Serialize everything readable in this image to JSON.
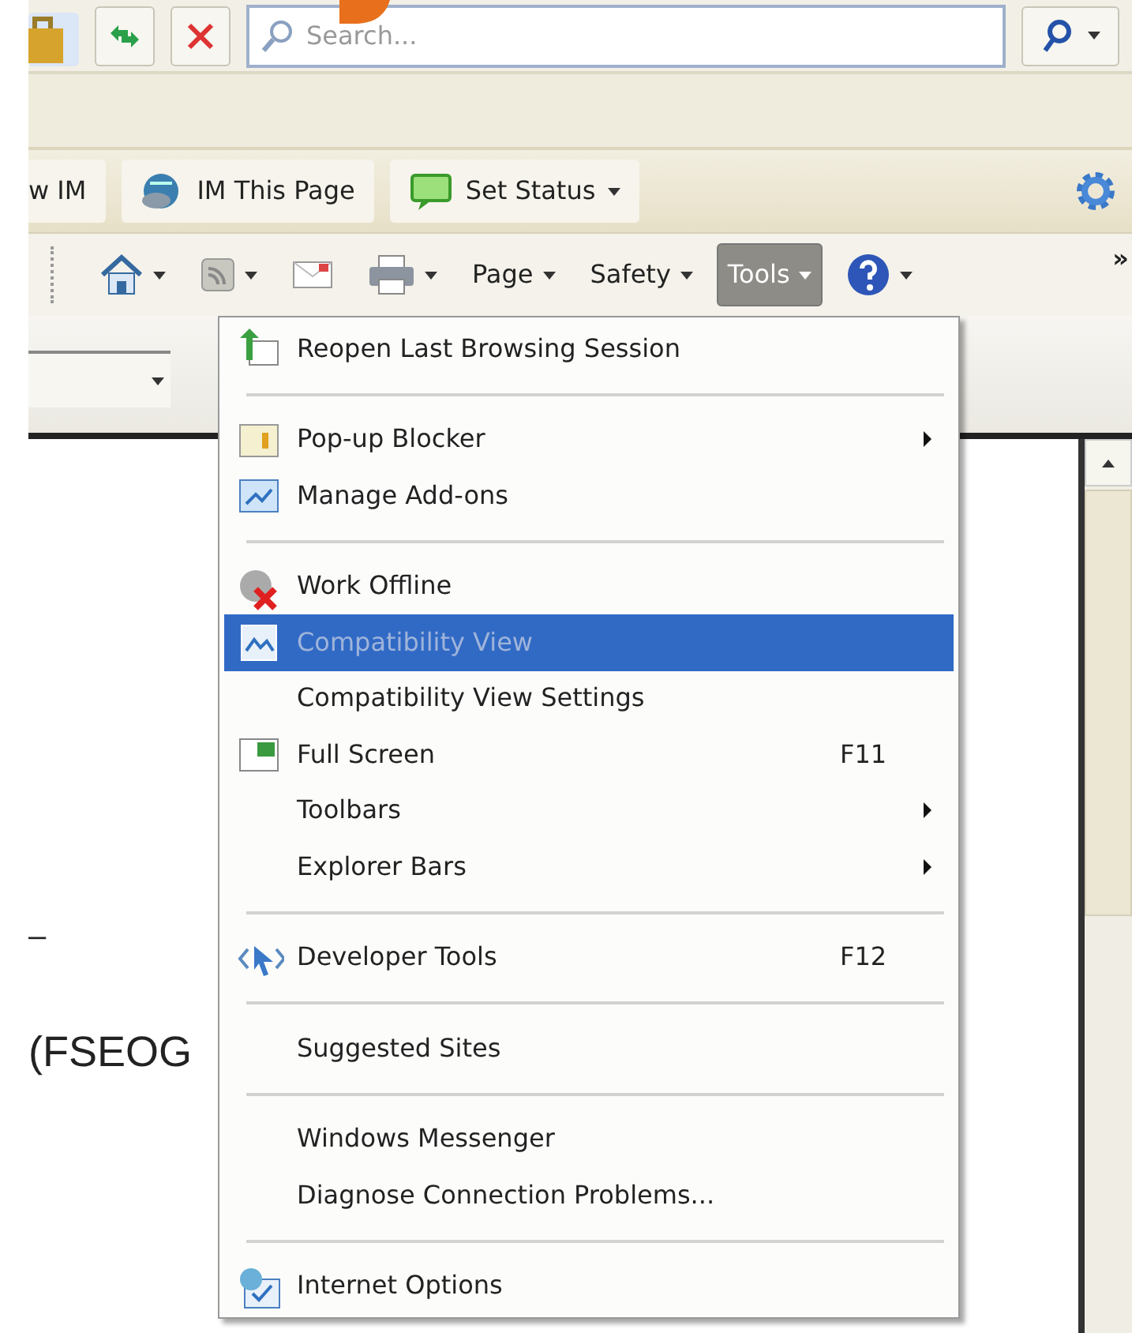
{
  "toolbar": {
    "search": {
      "placeholder": "Search..."
    }
  },
  "links_bar": {
    "buttons": [
      {
        "label": "w IM",
        "dropdown": false
      },
      {
        "label": "IM This Page",
        "dropdown": false
      },
      {
        "label": "Set Status",
        "dropdown": true
      }
    ]
  },
  "command_bar": {
    "buttons": [
      {
        "label": "Page",
        "selected": false
      },
      {
        "label": "Safety",
        "selected": false
      },
      {
        "label": "Tools",
        "selected": true
      }
    ],
    "overflow": "»"
  },
  "page": {
    "texts": [
      "–",
      "(FSEOG"
    ]
  },
  "tools_menu": {
    "items": [
      {
        "kind": "item",
        "label": "Reopen Last Browsing Session",
        "submenu": false,
        "selected": false,
        "disabled": false
      },
      {
        "kind": "separator"
      },
      {
        "kind": "item",
        "label": "Pop-up Blocker",
        "submenu": true,
        "selected": false,
        "disabled": false
      },
      {
        "kind": "item",
        "label": "Manage Add-ons",
        "submenu": false,
        "selected": false,
        "disabled": false
      },
      {
        "kind": "separator"
      },
      {
        "kind": "item",
        "label": "Work Offline",
        "submenu": false,
        "selected": false,
        "disabled": false
      },
      {
        "kind": "item",
        "label": "Compatibility View",
        "submenu": false,
        "selected": true,
        "disabled": true
      },
      {
        "kind": "item",
        "label": "Compatibility View Settings",
        "submenu": false,
        "selected": false,
        "disabled": false
      },
      {
        "kind": "item",
        "label": "Full Screen",
        "shortcut": "F11",
        "submenu": false,
        "selected": false,
        "disabled": false
      },
      {
        "kind": "item",
        "label": "Toolbars",
        "submenu": true,
        "selected": false,
        "disabled": false
      },
      {
        "kind": "item",
        "label": "Explorer Bars",
        "submenu": true,
        "selected": false,
        "disabled": false
      },
      {
        "kind": "separator"
      },
      {
        "kind": "item",
        "label": "Developer Tools",
        "shortcut": "F12",
        "submenu": false,
        "selected": false,
        "disabled": false
      },
      {
        "kind": "separator"
      },
      {
        "kind": "item",
        "label": "Suggested Sites",
        "submenu": false,
        "selected": false,
        "disabled": false
      },
      {
        "kind": "separator"
      },
      {
        "kind": "item",
        "label": "Windows Messenger",
        "submenu": false,
        "selected": false,
        "disabled": false
      },
      {
        "kind": "item",
        "label": "Diagnose Connection Problems...",
        "submenu": false,
        "selected": false,
        "disabled": false
      },
      {
        "kind": "separator"
      },
      {
        "kind": "item",
        "label": "Internet Options",
        "submenu": false,
        "selected": false,
        "disabled": false
      }
    ]
  }
}
